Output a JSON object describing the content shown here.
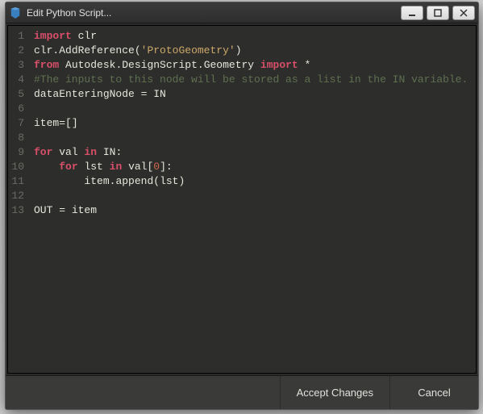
{
  "window": {
    "title": "Edit Python Script..."
  },
  "buttons": {
    "accept": "Accept Changes",
    "cancel": "Cancel"
  },
  "code": {
    "lines": [
      {
        "n": "1",
        "tokens": [
          {
            "t": "import ",
            "c": "kw-import"
          },
          {
            "t": "clr",
            "c": "ident"
          }
        ]
      },
      {
        "n": "2",
        "tokens": [
          {
            "t": "clr",
            "c": "ident"
          },
          {
            "t": ".",
            "c": "op"
          },
          {
            "t": "AddReference",
            "c": "func"
          },
          {
            "t": "(",
            "c": "op"
          },
          {
            "t": "'ProtoGeometry'",
            "c": "str"
          },
          {
            "t": ")",
            "c": "op"
          }
        ]
      },
      {
        "n": "3",
        "tokens": [
          {
            "t": "from ",
            "c": "kw-from"
          },
          {
            "t": "Autodesk",
            "c": "ident"
          },
          {
            "t": ".",
            "c": "op"
          },
          {
            "t": "DesignScript",
            "c": "ident"
          },
          {
            "t": ".",
            "c": "op"
          },
          {
            "t": "Geometry",
            "c": "ident"
          },
          {
            "t": " import ",
            "c": "kw-import"
          },
          {
            "t": "*",
            "c": "op"
          }
        ]
      },
      {
        "n": "4",
        "tokens": [
          {
            "t": "#The inputs to this node will be stored as a list in the IN variable.",
            "c": "comment"
          }
        ]
      },
      {
        "n": "5",
        "tokens": [
          {
            "t": "dataEnteringNode",
            "c": "ident"
          },
          {
            "t": " = ",
            "c": "op"
          },
          {
            "t": "IN",
            "c": "ident"
          }
        ]
      },
      {
        "n": "6",
        "tokens": []
      },
      {
        "n": "7",
        "tokens": [
          {
            "t": "item",
            "c": "ident"
          },
          {
            "t": "=[]",
            "c": "op"
          }
        ]
      },
      {
        "n": "8",
        "tokens": []
      },
      {
        "n": "9",
        "tokens": [
          {
            "t": "for ",
            "c": "kw-for"
          },
          {
            "t": "val",
            "c": "ident"
          },
          {
            "t": " in ",
            "c": "kw-in"
          },
          {
            "t": "IN",
            "c": "ident"
          },
          {
            "t": ":",
            "c": "op"
          }
        ]
      },
      {
        "n": "10",
        "tokens": [
          {
            "t": "    ",
            "c": "op"
          },
          {
            "t": "for ",
            "c": "kw-for"
          },
          {
            "t": "lst",
            "c": "ident"
          },
          {
            "t": " in ",
            "c": "kw-in"
          },
          {
            "t": "val",
            "c": "ident"
          },
          {
            "t": "[",
            "c": "op"
          },
          {
            "t": "0",
            "c": "num"
          },
          {
            "t": "]:",
            "c": "op"
          }
        ]
      },
      {
        "n": "11",
        "tokens": [
          {
            "t": "        ",
            "c": "op"
          },
          {
            "t": "item",
            "c": "ident"
          },
          {
            "t": ".",
            "c": "op"
          },
          {
            "t": "append",
            "c": "func"
          },
          {
            "t": "(",
            "c": "op"
          },
          {
            "t": "lst",
            "c": "ident"
          },
          {
            "t": ")",
            "c": "op"
          }
        ]
      },
      {
        "n": "12",
        "tokens": []
      },
      {
        "n": "13",
        "tokens": [
          {
            "t": "OUT",
            "c": "ident"
          },
          {
            "t": " = ",
            "c": "op"
          },
          {
            "t": "item",
            "c": "ident"
          }
        ]
      }
    ]
  }
}
